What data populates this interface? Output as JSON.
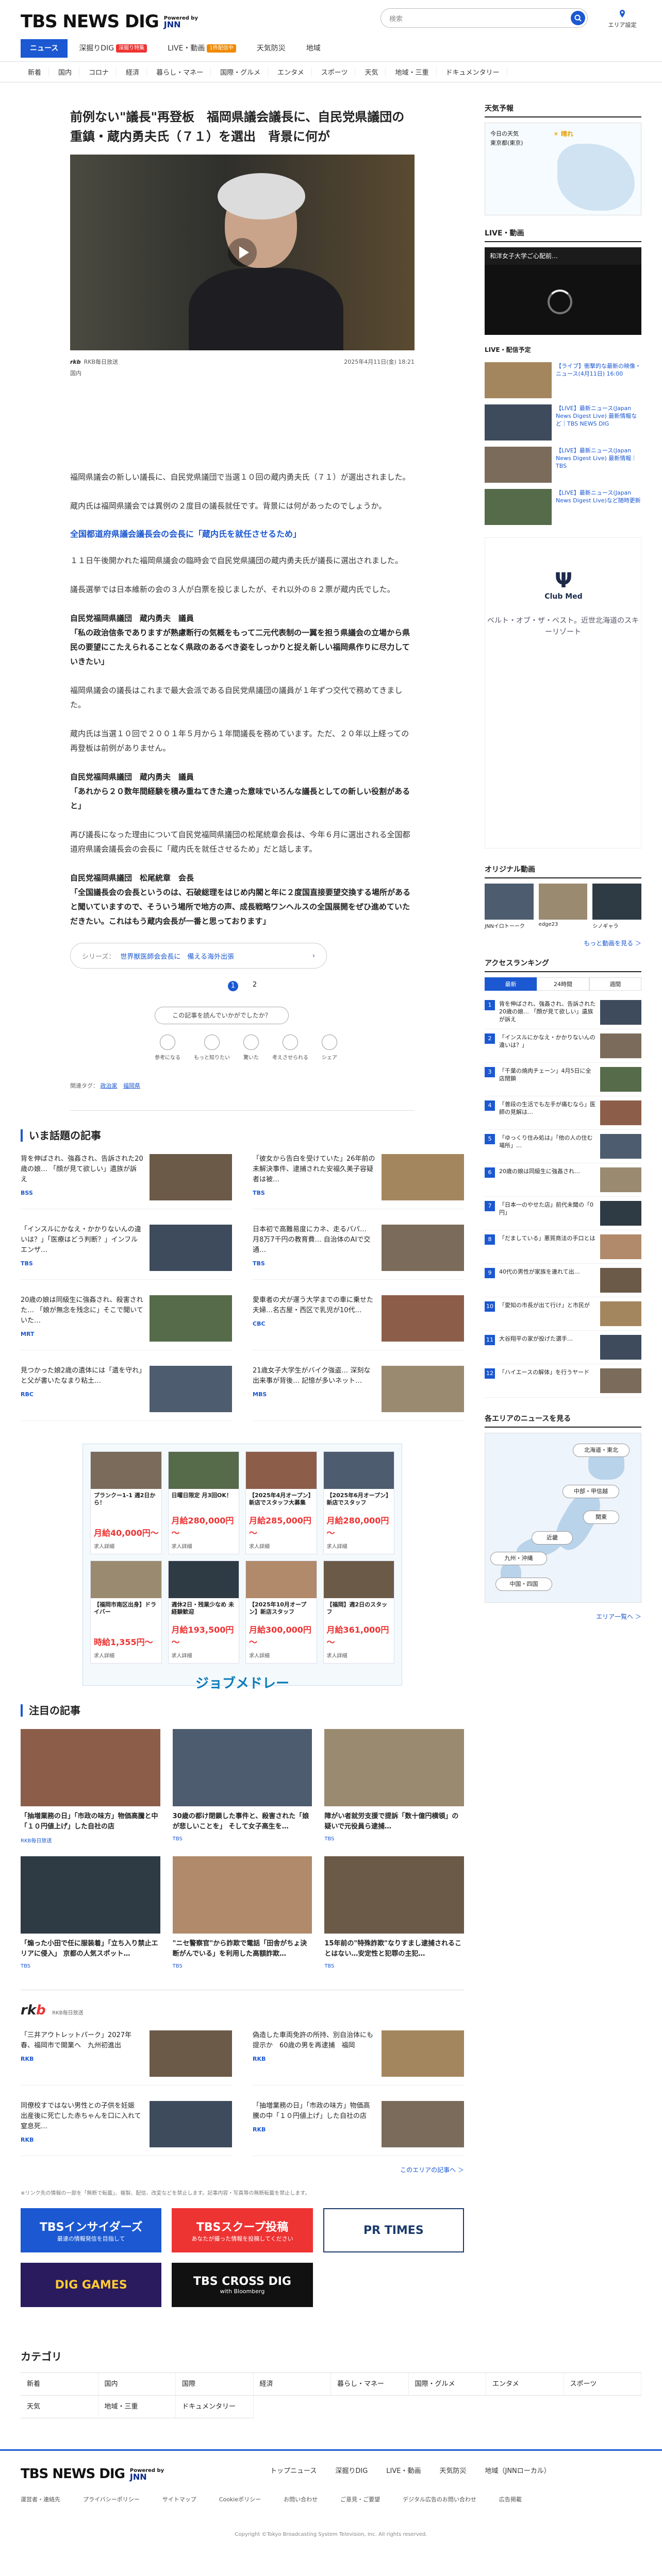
{
  "header": {
    "logo": "TBS NEWS DIG",
    "logo_powered": "Powered by",
    "logo_jnn": "JNN",
    "search_placeholder": "検索",
    "area_label": "エリア設定",
    "tabs": [
      {
        "label": "ニュース",
        "active": true
      },
      {
        "label": "深掘りDIG",
        "badge": "深掘り特集"
      },
      {
        "label": "LIVE・動画",
        "badge": "1件配信中"
      },
      {
        "label": "天気防災"
      },
      {
        "label": "地域"
      }
    ],
    "nav": [
      "新着",
      "国内",
      "コロナ",
      "経済",
      "暮らし・マネー",
      "国際・グルメ",
      "エンタメ",
      "スポーツ",
      "天気",
      "地域・三重",
      "ドキュメンタリー"
    ]
  },
  "article": {
    "title": "前例ない\"議長\"再登板　福岡県議会議長に、自民党県議団の重鎮・蔵内勇夫氏（７１）を選出　背景に何が",
    "source": "RKB毎日放送",
    "date": "2025年4月11日(金) 18:21",
    "category": "国内",
    "paragraphs": [
      "福岡県議会の新しい議長に、自民党県議団で当選１０回の蔵内勇夫氏（７１）が選出されました。",
      "蔵内氏は福岡県議会では異例の２度目の議長就任です。背景には何があったのでしょうか。"
    ],
    "heading1": "全国都道府県議会議長会の会長に「蔵内氏を就任させるため」",
    "paragraphs2": [
      "１１日午後開かれた福岡県議会の臨時会で自民党県議団の蔵内勇夫氏が議長に選出されました。",
      "議長選挙では日本維新の会の３人が白票を投じましたが、それ以外の８２票が蔵内氏でした。"
    ],
    "quote1_label": "自民党福岡県議団　蔵内勇夫　議員",
    "quote1": "「私の政治信条でありますが熟慮断行の気概をもって二元代表制の一翼を担う県議会の立場から県民の要望にこたえられることなく県政のあるべき姿をしっかりと捉え新しい福岡県作りに尽力していきたい」",
    "paragraphs3": [
      "福岡県議会の議長はこれまで最大会派である自民党県議団の議員が１年ずつ交代で務めてきました。",
      "蔵内氏は当選１０回で２００１年５月から１年間議長を務めています。ただ、２０年以上経っての再登板は前例がありません。"
    ],
    "quote2_label": "自民党福岡県議団　蔵内勇夫　議員",
    "quote2": "「あれから２０数年間経験を積み重ねてきた違った意味でいろんな議長としての新しい役割があると」",
    "paragraphs4": [
      "再び議長になった理由について自民党福岡県議団の松尾統章会長は、今年６月に選出される全国都道府県議会議長会の会長に「蔵内氏を就任させるため」だと話します。"
    ],
    "quote3_label": "自民党福岡県議団　松尾統章　会長",
    "quote3": "「全国議長会の会長というのは、石破総理をはじめ内閣と年に２度国直接要望交換する場所があると聞いていますので、そういう場所で地方の声、成長戦略ワンヘルスの全国展開をぜひ進めていただきたい。これはもう蔵内会長が一番と思っております」",
    "series_label": "シリーズ：",
    "series_text": "世界獣医師会会長に　備える海外出張",
    "pages": [
      "1",
      "2"
    ],
    "react_ask": "この記事を読んでいかがでしたか？",
    "reacts": [
      "参考になる",
      "もっと知りたい",
      "驚いた",
      "考えさせられる",
      "シェア"
    ],
    "tags_label": "関連タグ：",
    "tags": [
      "政治家",
      "福岡県"
    ]
  },
  "trending": {
    "heading": "いま話題の記事",
    "items": [
      {
        "title": "背を伸ばされ、強姦され、告訴された20歳の娘… 「顔が見て欲しい」遺族が訴え",
        "src": "BSS"
      },
      {
        "title": "「彼女から告白を受けていた」26年前の未解決事件、逮捕された安福久美子容疑者は被…",
        "src": "TBS"
      },
      {
        "title": "「インスルにかなえ・かかりないんの違いは？」「医療はどう判断？」インフルエンザ…",
        "src": "TBS"
      },
      {
        "title": "日本初で高難易度にカネ、走るパパ… 月8万7千円の教育費… 自治体のAIで交通…",
        "src": "TBS"
      },
      {
        "title": "20歳の娘は同級生に強姦され、殺害された… 「娘が無念を残念に」そこで聞いていた…",
        "src": "MRT"
      },
      {
        "title": "愛車者の犬が運う大学までの車に乗せた夫婦…名古屋・西区で乳児が10代…",
        "src": "CBC"
      },
      {
        "title": "見つかった娘2歳の遺体には「遺を守れ」と父が書いたなまり粘土…",
        "src": "RBC"
      },
      {
        "title": "21歳女子大学生がバイク強盗… 深刻な出来事が背後… 記憶が多いネット…",
        "src": "MBS"
      }
    ]
  },
  "ad": {
    "cells": [
      {
        "text": "プランクー1-1 週2日から！",
        "price": "月給40,000円～",
        "label": "求人詳細"
      },
      {
        "text": "日曜日限定 月3回OK！",
        "price": "月給280,000円～",
        "label": "求人詳細"
      },
      {
        "text": "【2025年4月オープン】新店でスタッフ大募集",
        "price": "月給285,000円～",
        "label": "求人詳細"
      },
      {
        "text": "【2025年6月オープン】新店でスタッフ",
        "price": "月給280,000円～",
        "label": "求人詳細"
      },
      {
        "text": "【福岡市南区出身】ドライバー",
        "price": "時給1,355円～",
        "label": "求人詳細"
      },
      {
        "text": "週休2日・残業少なめ 未経験歓迎",
        "price": "月給193,500円～",
        "label": "求人詳細"
      },
      {
        "text": "【2025年10月オープン】新店スタッフ",
        "price": "月給300,000円～",
        "label": "求人詳細"
      },
      {
        "text": "【福岡】週2日のスタッフ",
        "price": "月給361,000円～",
        "label": "求人詳細"
      }
    ],
    "logo": "ジョブメドレー"
  },
  "featured": {
    "heading": "注目の記事",
    "items": [
      {
        "title": "「抽増業務の日」「市政の味方」物価高騰と中「１０円値上げ」した自社の店",
        "src": "RKB毎日放送"
      },
      {
        "title": "30歳の都け閉鎖した事件と、殺害された「娘が悲しいことを」 そして女子高生を…",
        "src": "TBS"
      },
      {
        "title": "障がい者就労支援で提訴「数十億円横領」の疑いで元役員ら逮捕…",
        "src": "TBS"
      },
      {
        "title": "「煽った小田で任に服装着」「立ち入り禁止エリアに侵入」 京都の人気スポット…",
        "src": "TBS"
      },
      {
        "title": "\"ニセ警察官\"から詐欺で電話「田舎がちょ決断がんでいる」を利用した高額詐欺…",
        "src": "TBS"
      },
      {
        "title": "15年前の\"特殊詐欺\"なりすまし逮捕されることはない…安定性と犯罪の主犯… ",
        "src": "TBS"
      }
    ]
  },
  "rkb": {
    "logo_a": "rk",
    "logo_b": "b",
    "logo_sub": "RKB毎日放送",
    "items": [
      {
        "title": "「三井アウトレットパーク」2027年春、福岡市で開業へ　九州初進出",
        "src": "RKB"
      },
      {
        "title": "偽造した車両免許の所持、別自治体にも提示か　60歳の男を再逮捕　福岡",
        "src": "RKB"
      },
      {
        "title": "同僚校すではない男性との子供を妊娠　出産後に死亡した赤ちゃんを口に入れて窒息死…",
        "src": "RKB"
      },
      {
        "title": "「抽増業務の日」「市政の味方」物価高騰の中「１０円値上げ」した自社の店",
        "src": "RKB"
      }
    ],
    "more": "このエリアの記事へ ＞"
  },
  "footnote": "※リンク先の情報の一部を「無断で転載」、複製、配信、改変などを禁止します。記事内容・写真等の無断転載を禁止します。",
  "banners": [
    {
      "label": "TBSインサイダーズ",
      "sub": "最速の情報発信を目指して"
    },
    {
      "label": "TBSスクープ投稿",
      "sub": "あなたが撮った情報を投稿してください"
    },
    {
      "label": "PR TIMES"
    },
    {
      "label": "DIG GAMES"
    },
    {
      "label": "TBS CROSS DIG",
      "sub": "with Bloomberg"
    }
  ],
  "categories": {
    "heading": "カテゴリ",
    "items": [
      "新着",
      "国内",
      "国際",
      "経済",
      "暮らし・マネー",
      "国際・グルメ",
      "エンタメ",
      "スポーツ",
      "天気",
      "地域・三重",
      "ドキュメンタリー"
    ]
  },
  "footer": {
    "links": [
      "トップニュース",
      "深掘りDIG",
      "LIVE・動画",
      "天気防災",
      "地域（JNNローカル）"
    ],
    "links2": [
      "運営者・連絡先",
      "プライバシーポリシー",
      "サイトマップ",
      "Cookieポリシー",
      "お問い合わせ",
      "ご意見・ご要望",
      "デジタル広告のお問い合わせ",
      "広告掲載"
    ],
    "copyright": "Copyright ©Tokyo Broadcasting System Television, Inc. All rights reserved."
  },
  "sidebar": {
    "weather_heading": "天気予報",
    "weather_today": "今日の天気",
    "weather_region": "東京都(東京)",
    "weather_status": "晴れ",
    "live_heading": "LIVE・動画",
    "live_title": "和洋女子大学ご心配前…",
    "sched_heading": "LIVE・配信予定",
    "sched": [
      "【ライブ】衝撃的な最新の映像・ニュース(4月11日) 16:00",
      "【LIVE】最新ニュース(Japan News Digest Live) 最新情報など｜TBS NEWS DIG",
      "【LIVE】最新ニュース(Japan News Digest Live) 最新情報｜TBS",
      "【LIVE】最新ニュース(Japan News Digest Live)など随時更新"
    ],
    "ad_brand": "Club Med",
    "ad_text": "ベルト・オブ・ザ・ベスト。近世北海道のスキーリゾート",
    "orig_heading": "オリジナル動画",
    "orig": [
      "JNNイロトーーク",
      "edge23",
      "シノギャラ"
    ],
    "orig_more": "もっと動画を見る ＞",
    "rank_heading": "アクセスランキング",
    "rank_tabs": [
      "最新",
      "24時間",
      "週間"
    ],
    "ranks": [
      "背を伸ばされ、強姦され、告訴された20歳の娘… 「顔が見て欲しい」遺族が訴え",
      "「インスルにかなえ・かかりないんの違いは？」",
      "「千葉の焼肉チェーン」4月5日に全店閉鎖",
      "「普段の生活でも左手が痛むなら」医師の見解は…",
      "「ゆっくり住み処は」「他の人の住む場所」…",
      "20歳の娘は同級生に強姦され…",
      "「日本一のやせた店」前代未聞の「0円」",
      "「だましている」悪質商法の手口とは",
      "40代の男性が家族を連れて出…",
      "「愛知の市長が出て行け」と市民が",
      "大谷翔平の家が投げた選手…",
      "「ハイエースの解体」を行うヤード"
    ],
    "map_heading": "各エリアのニュースを見る",
    "map_areas": [
      "北海道・東北",
      "中部・甲信越",
      "関東",
      "近畿",
      "九州・沖縄",
      "中国・四国"
    ],
    "map_more": "エリア一覧へ ＞"
  }
}
